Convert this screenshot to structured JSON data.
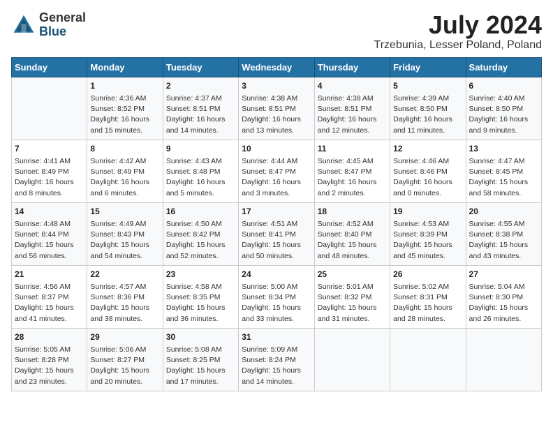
{
  "header": {
    "logo_general": "General",
    "logo_blue": "Blue",
    "month_year": "July 2024",
    "location": "Trzebunia, Lesser Poland, Poland"
  },
  "days_of_week": [
    "Sunday",
    "Monday",
    "Tuesday",
    "Wednesday",
    "Thursday",
    "Friday",
    "Saturday"
  ],
  "weeks": [
    [
      {
        "day": "",
        "info": ""
      },
      {
        "day": "1",
        "info": "Sunrise: 4:36 AM\nSunset: 8:52 PM\nDaylight: 16 hours\nand 15 minutes."
      },
      {
        "day": "2",
        "info": "Sunrise: 4:37 AM\nSunset: 8:51 PM\nDaylight: 16 hours\nand 14 minutes."
      },
      {
        "day": "3",
        "info": "Sunrise: 4:38 AM\nSunset: 8:51 PM\nDaylight: 16 hours\nand 13 minutes."
      },
      {
        "day": "4",
        "info": "Sunrise: 4:38 AM\nSunset: 8:51 PM\nDaylight: 16 hours\nand 12 minutes."
      },
      {
        "day": "5",
        "info": "Sunrise: 4:39 AM\nSunset: 8:50 PM\nDaylight: 16 hours\nand 11 minutes."
      },
      {
        "day": "6",
        "info": "Sunrise: 4:40 AM\nSunset: 8:50 PM\nDaylight: 16 hours\nand 9 minutes."
      }
    ],
    [
      {
        "day": "7",
        "info": "Sunrise: 4:41 AM\nSunset: 8:49 PM\nDaylight: 16 hours\nand 8 minutes."
      },
      {
        "day": "8",
        "info": "Sunrise: 4:42 AM\nSunset: 8:49 PM\nDaylight: 16 hours\nand 6 minutes."
      },
      {
        "day": "9",
        "info": "Sunrise: 4:43 AM\nSunset: 8:48 PM\nDaylight: 16 hours\nand 5 minutes."
      },
      {
        "day": "10",
        "info": "Sunrise: 4:44 AM\nSunset: 8:47 PM\nDaylight: 16 hours\nand 3 minutes."
      },
      {
        "day": "11",
        "info": "Sunrise: 4:45 AM\nSunset: 8:47 PM\nDaylight: 16 hours\nand 2 minutes."
      },
      {
        "day": "12",
        "info": "Sunrise: 4:46 AM\nSunset: 8:46 PM\nDaylight: 16 hours\nand 0 minutes."
      },
      {
        "day": "13",
        "info": "Sunrise: 4:47 AM\nSunset: 8:45 PM\nDaylight: 15 hours\nand 58 minutes."
      }
    ],
    [
      {
        "day": "14",
        "info": "Sunrise: 4:48 AM\nSunset: 8:44 PM\nDaylight: 15 hours\nand 56 minutes."
      },
      {
        "day": "15",
        "info": "Sunrise: 4:49 AM\nSunset: 8:43 PM\nDaylight: 15 hours\nand 54 minutes."
      },
      {
        "day": "16",
        "info": "Sunrise: 4:50 AM\nSunset: 8:42 PM\nDaylight: 15 hours\nand 52 minutes."
      },
      {
        "day": "17",
        "info": "Sunrise: 4:51 AM\nSunset: 8:41 PM\nDaylight: 15 hours\nand 50 minutes."
      },
      {
        "day": "18",
        "info": "Sunrise: 4:52 AM\nSunset: 8:40 PM\nDaylight: 15 hours\nand 48 minutes."
      },
      {
        "day": "19",
        "info": "Sunrise: 4:53 AM\nSunset: 8:39 PM\nDaylight: 15 hours\nand 45 minutes."
      },
      {
        "day": "20",
        "info": "Sunrise: 4:55 AM\nSunset: 8:38 PM\nDaylight: 15 hours\nand 43 minutes."
      }
    ],
    [
      {
        "day": "21",
        "info": "Sunrise: 4:56 AM\nSunset: 8:37 PM\nDaylight: 15 hours\nand 41 minutes."
      },
      {
        "day": "22",
        "info": "Sunrise: 4:57 AM\nSunset: 8:36 PM\nDaylight: 15 hours\nand 38 minutes."
      },
      {
        "day": "23",
        "info": "Sunrise: 4:58 AM\nSunset: 8:35 PM\nDaylight: 15 hours\nand 36 minutes."
      },
      {
        "day": "24",
        "info": "Sunrise: 5:00 AM\nSunset: 8:34 PM\nDaylight: 15 hours\nand 33 minutes."
      },
      {
        "day": "25",
        "info": "Sunrise: 5:01 AM\nSunset: 8:32 PM\nDaylight: 15 hours\nand 31 minutes."
      },
      {
        "day": "26",
        "info": "Sunrise: 5:02 AM\nSunset: 8:31 PM\nDaylight: 15 hours\nand 28 minutes."
      },
      {
        "day": "27",
        "info": "Sunrise: 5:04 AM\nSunset: 8:30 PM\nDaylight: 15 hours\nand 26 minutes."
      }
    ],
    [
      {
        "day": "28",
        "info": "Sunrise: 5:05 AM\nSunset: 8:28 PM\nDaylight: 15 hours\nand 23 minutes."
      },
      {
        "day": "29",
        "info": "Sunrise: 5:06 AM\nSunset: 8:27 PM\nDaylight: 15 hours\nand 20 minutes."
      },
      {
        "day": "30",
        "info": "Sunrise: 5:08 AM\nSunset: 8:25 PM\nDaylight: 15 hours\nand 17 minutes."
      },
      {
        "day": "31",
        "info": "Sunrise: 5:09 AM\nSunset: 8:24 PM\nDaylight: 15 hours\nand 14 minutes."
      },
      {
        "day": "",
        "info": ""
      },
      {
        "day": "",
        "info": ""
      },
      {
        "day": "",
        "info": ""
      }
    ]
  ]
}
